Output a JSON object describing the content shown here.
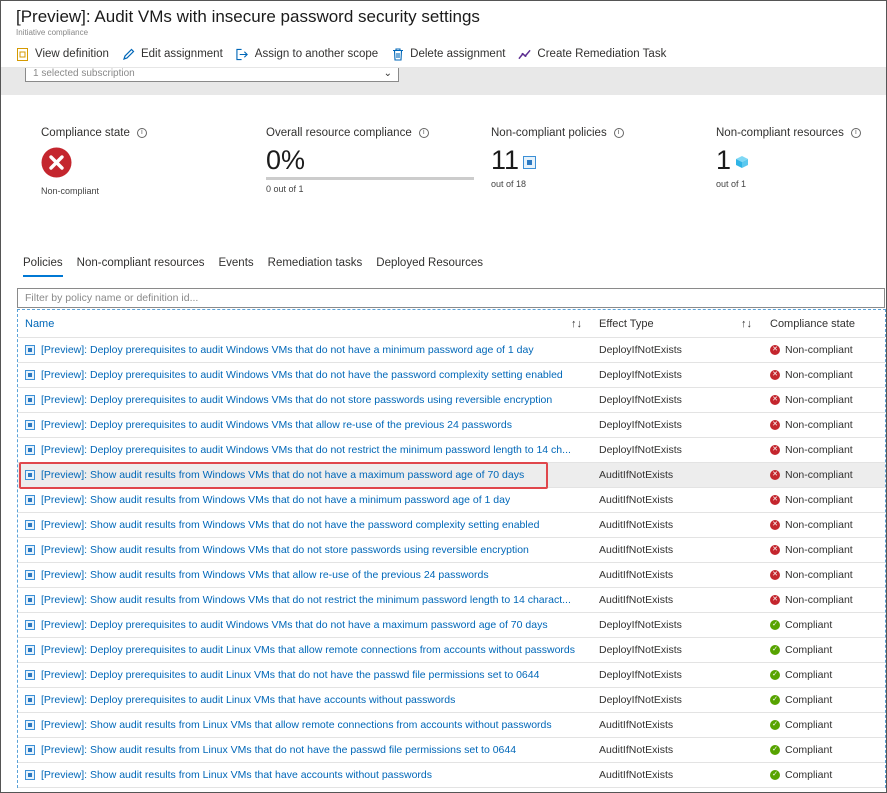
{
  "header": {
    "title": "[Preview]: Audit VMs with insecure password security settings",
    "subtitle": "Initiative compliance"
  },
  "toolbar": {
    "view_definition": "View definition",
    "edit_assignment": "Edit assignment",
    "assign_scope": "Assign to another scope",
    "delete_assignment": "Delete assignment",
    "create_remediation": "Create Remediation Task"
  },
  "scope": {
    "value": "1 selected subscription"
  },
  "metrics": {
    "compliance_state": {
      "label": "Compliance state",
      "value": "Non-compliant"
    },
    "overall": {
      "label": "Overall resource compliance",
      "value": "0%",
      "sub": "0 out of 1",
      "progress_fraction": 0
    },
    "noncompliant_policies": {
      "label": "Non-compliant policies",
      "value": "11",
      "sub": "out of 18"
    },
    "noncompliant_resources": {
      "label": "Non-compliant resources",
      "value": "1",
      "sub": "out of 1"
    }
  },
  "tabs": [
    "Policies",
    "Non-compliant resources",
    "Events",
    "Remediation tasks",
    "Deployed Resources"
  ],
  "filter": {
    "placeholder": "Filter by policy name or definition id..."
  },
  "table": {
    "columns": {
      "name": "Name",
      "effect": "Effect Type",
      "state": "Compliance state"
    },
    "rows": [
      {
        "name": "[Preview]: Deploy prerequisites to audit Windows VMs that do not have a minimum password age of 1 day",
        "effect": "DeployIfNotExists",
        "state": "Non-compliant"
      },
      {
        "name": "[Preview]: Deploy prerequisites to audit Windows VMs that do not have the password complexity setting enabled",
        "effect": "DeployIfNotExists",
        "state": "Non-compliant"
      },
      {
        "name": "[Preview]: Deploy prerequisites to audit Windows VMs that do not store passwords using reversible encryption",
        "effect": "DeployIfNotExists",
        "state": "Non-compliant"
      },
      {
        "name": "[Preview]: Deploy prerequisites to audit Windows VMs that allow re-use of the previous 24 passwords",
        "effect": "DeployIfNotExists",
        "state": "Non-compliant"
      },
      {
        "name": "[Preview]: Deploy prerequisites to audit Windows VMs that do not restrict the minimum password length to 14 ch...",
        "effect": "DeployIfNotExists",
        "state": "Non-compliant"
      },
      {
        "name": "[Preview]: Show audit results from Windows VMs that do not have a maximum password age of 70 days",
        "effect": "AuditIfNotExists",
        "state": "Non-compliant"
      },
      {
        "name": "[Preview]: Show audit results from Windows VMs that do not have a minimum password age of 1 day",
        "effect": "AuditIfNotExists",
        "state": "Non-compliant"
      },
      {
        "name": "[Preview]: Show audit results from Windows VMs that do not have the password complexity setting enabled",
        "effect": "AuditIfNotExists",
        "state": "Non-compliant"
      },
      {
        "name": "[Preview]: Show audit results from Windows VMs that do not store passwords using reversible encryption",
        "effect": "AuditIfNotExists",
        "state": "Non-compliant"
      },
      {
        "name": "[Preview]: Show audit results from Windows VMs that allow re-use of the previous 24 passwords",
        "effect": "AuditIfNotExists",
        "state": "Non-compliant"
      },
      {
        "name": "[Preview]: Show audit results from Windows VMs that do not restrict the minimum password length to 14 charact...",
        "effect": "AuditIfNotExists",
        "state": "Non-compliant"
      },
      {
        "name": "[Preview]: Deploy prerequisites to audit Windows VMs that do not have a maximum password age of 70 days",
        "effect": "DeployIfNotExists",
        "state": "Compliant"
      },
      {
        "name": "[Preview]: Deploy prerequisites to audit Linux VMs that allow remote connections from accounts without passwords",
        "effect": "DeployIfNotExists",
        "state": "Compliant"
      },
      {
        "name": "[Preview]: Deploy prerequisites to audit Linux VMs that do not have the passwd file permissions set to 0644",
        "effect": "DeployIfNotExists",
        "state": "Compliant"
      },
      {
        "name": "[Preview]: Deploy prerequisites to audit Linux VMs that have accounts without passwords",
        "effect": "DeployIfNotExists",
        "state": "Compliant"
      },
      {
        "name": "[Preview]: Show audit results from Linux VMs that allow remote connections from accounts without passwords",
        "effect": "AuditIfNotExists",
        "state": "Compliant"
      },
      {
        "name": "[Preview]: Show audit results from Linux VMs that do not have the passwd file permissions set to 0644",
        "effect": "AuditIfNotExists",
        "state": "Compliant"
      },
      {
        "name": "[Preview]: Show audit results from Linux VMs that have accounts without passwords",
        "effect": "AuditIfNotExists",
        "state": "Compliant"
      }
    ]
  },
  "colors": {
    "link": "#0067b8",
    "noncompliant": "#c4262e",
    "compliant": "#57a300",
    "accent": "#0078d4",
    "highlight": "#e0474c"
  }
}
